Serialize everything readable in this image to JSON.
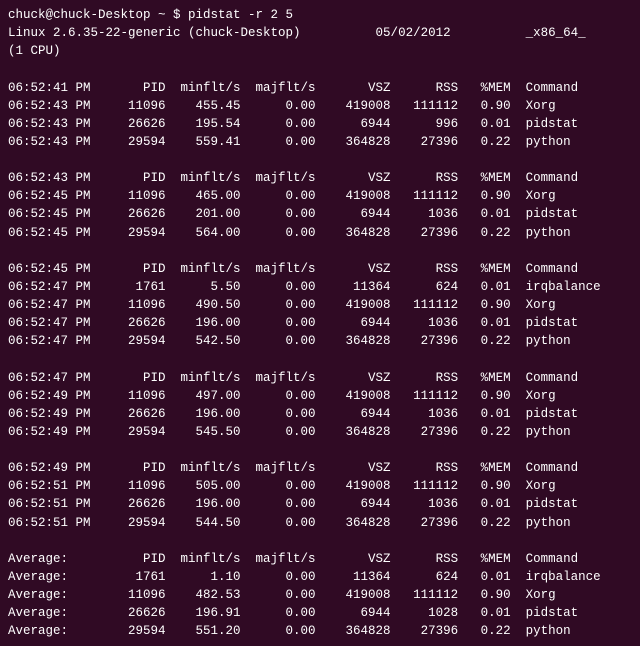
{
  "terminal": {
    "lines": [
      "chuck@chuck-Desktop ~ $ pidstat -r 2 5",
      "Linux 2.6.35-22-generic (chuck-Desktop)          05/02/2012          _x86_64_",
      "(1 CPU)",
      "",
      "06:52:41 PM       PID  minflt/s  majflt/s       VSZ      RSS   %MEM  Command",
      "06:52:43 PM     11096    455.45      0.00    419008   111112   0.90  Xorg",
      "06:52:43 PM     26626    195.54      0.00      6944      996   0.01  pidstat",
      "06:52:43 PM     29594    559.41      0.00    364828    27396   0.22  python",
      "",
      "06:52:43 PM       PID  minflt/s  majflt/s       VSZ      RSS   %MEM  Command",
      "06:52:45 PM     11096    465.00      0.00    419008   111112   0.90  Xorg",
      "06:52:45 PM     26626    201.00      0.00      6944     1036   0.01  pidstat",
      "06:52:45 PM     29594    564.00      0.00    364828    27396   0.22  python",
      "",
      "06:52:45 PM       PID  minflt/s  majflt/s       VSZ      RSS   %MEM  Command",
      "06:52:47 PM      1761      5.50      0.00     11364      624   0.01  irqbalance",
      "06:52:47 PM     11096    490.50      0.00    419008   111112   0.90  Xorg",
      "06:52:47 PM     26626    196.00      0.00      6944     1036   0.01  pidstat",
      "06:52:47 PM     29594    542.50      0.00    364828    27396   0.22  python",
      "",
      "06:52:47 PM       PID  minflt/s  majflt/s       VSZ      RSS   %MEM  Command",
      "06:52:49 PM     11096    497.00      0.00    419008   111112   0.90  Xorg",
      "06:52:49 PM     26626    196.00      0.00      6944     1036   0.01  pidstat",
      "06:52:49 PM     29594    545.50      0.00    364828    27396   0.22  python",
      "",
      "06:52:49 PM       PID  minflt/s  majflt/s       VSZ      RSS   %MEM  Command",
      "06:52:51 PM     11096    505.00      0.00    419008   111112   0.90  Xorg",
      "06:52:51 PM     26626    196.00      0.00      6944     1036   0.01  pidstat",
      "06:52:51 PM     29594    544.50      0.00    364828    27396   0.22  python",
      "",
      "Average:          PID  minflt/s  majflt/s       VSZ      RSS   %MEM  Command",
      "Average:         1761      1.10      0.00     11364      624   0.01  irqbalance",
      "Average:        11096    482.53      0.00    419008   111112   0.90  Xorg",
      "Average:        26626    196.91      0.00      6944     1028   0.01  pidstat",
      "Average:        29594    551.20      0.00    364828    27396   0.22  python"
    ]
  }
}
